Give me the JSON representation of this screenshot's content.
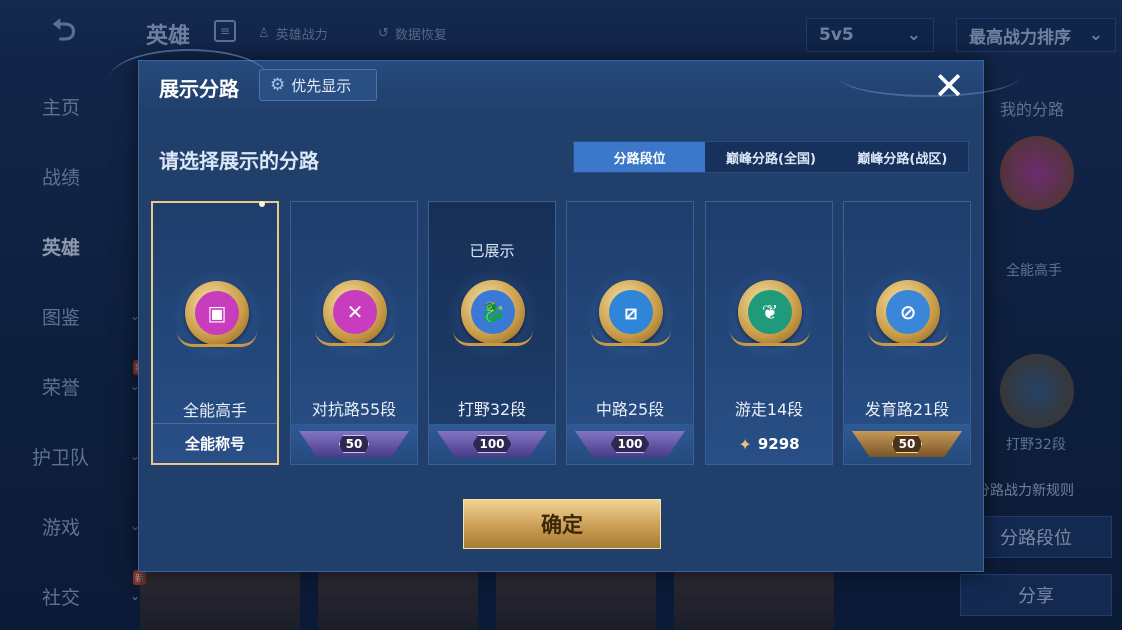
{
  "background": {
    "back_icon": "back-arrow-icon",
    "title": "英雄",
    "link_power": "英雄战力",
    "link_restore": "数据恢复",
    "mode_select": "5v5",
    "sort_select": "最高战力排序",
    "sidebar": [
      {
        "label": "主页"
      },
      {
        "label": "战绩"
      },
      {
        "label": "英雄",
        "active": true
      },
      {
        "label": "图鉴"
      },
      {
        "label": "荣誉",
        "badge": "新"
      },
      {
        "label": "护卫队"
      },
      {
        "label": "游戏"
      },
      {
        "label": "社交",
        "badge": "新"
      }
    ],
    "right_panel": {
      "title": "我的分路",
      "badge1_label": "全能高手",
      "badge2_label": "打野32段",
      "note": "分路战力新规则",
      "btn_route": "分路段位",
      "btn_share": "分享"
    }
  },
  "dialog": {
    "title": "展示分路",
    "priority_label": "优先显示",
    "close_icon": "close-icon",
    "subtitle": "请选择展示的分路",
    "tabs": [
      {
        "label": "分路段位",
        "active": true
      },
      {
        "label": "巅峰分路(全国)",
        "active": false
      },
      {
        "label": "巅峰分路(战区)",
        "active": false
      }
    ],
    "cards": [
      {
        "name": "全能高手",
        "footer": "全能称号",
        "status": "",
        "color": "#c73dbd",
        "selected": true
      },
      {
        "name": "对抗路55段",
        "footer_badge": "50",
        "status": "",
        "color": "#c73dbd"
      },
      {
        "name": "打野32段",
        "footer_badge": "100",
        "status": "已展示",
        "color": "#3a79d6"
      },
      {
        "name": "中路25段",
        "footer_badge": "100",
        "status": "",
        "color": "#2f85d8"
      },
      {
        "name": "游走14段",
        "footer_value": "9298",
        "status": "",
        "color": "#1f9a7a"
      },
      {
        "name": "发育路21段",
        "footer_badge": "50",
        "status": "",
        "color": "#3a86d8",
        "gold": true
      }
    ],
    "confirm_label": "确定"
  }
}
